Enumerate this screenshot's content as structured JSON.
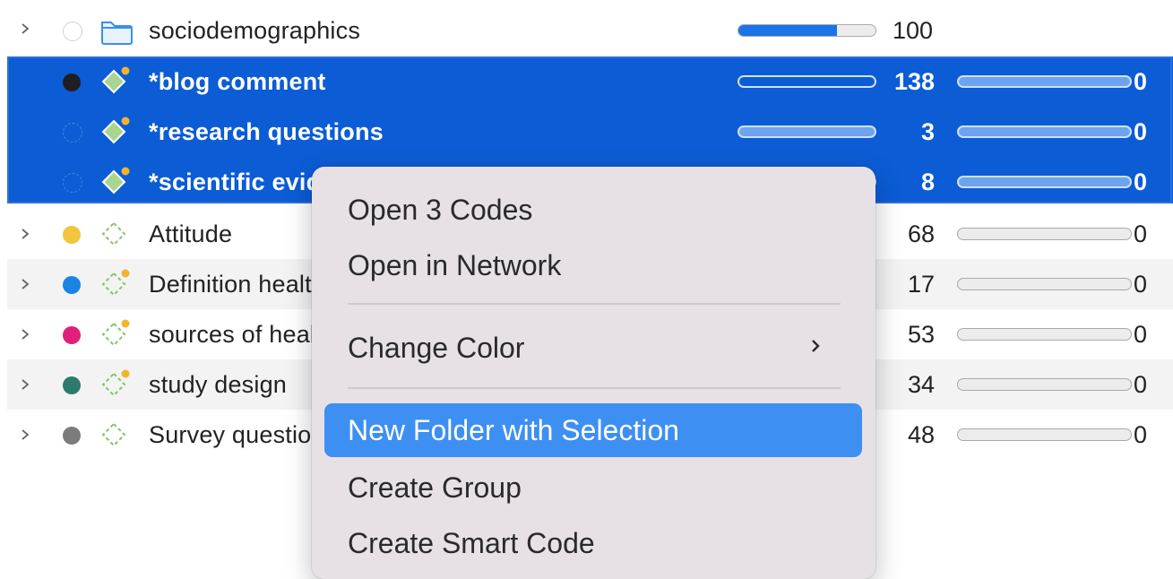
{
  "rows": [
    {
      "name": "sociodemographics",
      "type": "folder",
      "count": "100",
      "fill": 0.72,
      "second": ""
    },
    {
      "name": "*blog comment",
      "type": "code-selected",
      "count": "138",
      "second": "0",
      "color": "#1f1f1f"
    },
    {
      "name": "*research questions",
      "type": "code-selected",
      "count": "3",
      "second": "0"
    },
    {
      "name": "*scientific evidence",
      "type": "code-selected",
      "count": "8",
      "second": "0"
    },
    {
      "name": "Attitude",
      "type": "code",
      "count": "68",
      "second": "0",
      "color": "#f2c53d"
    },
    {
      "name": "Definition health literacy",
      "type": "code",
      "count": "17",
      "second": "0",
      "color": "#1a84e6"
    },
    {
      "name": "sources of health information",
      "type": "code",
      "count": "53",
      "second": "0",
      "color": "#e0207a"
    },
    {
      "name": "study design",
      "type": "code",
      "count": "34",
      "second": "0",
      "color": "#2e7a6d"
    },
    {
      "name": "Survey questions",
      "type": "code",
      "count": "48",
      "second": "0",
      "color": "#7c7c7c"
    }
  ],
  "menu": {
    "open_codes": "Open 3 Codes",
    "open_network": "Open in Network",
    "change_color": "Change Color",
    "new_folder": "New Folder with Selection",
    "create_group": "Create Group",
    "create_smart": "Create Smart Code"
  },
  "icons": {
    "chevron": "chevron-right-icon",
    "folder": "folder-icon",
    "code": "code-diamond-icon",
    "submenu": "chevron-right-icon"
  },
  "colors": {
    "selection": "#0b5cd5",
    "highlight": "#3d8ff2",
    "accent": "#1a73e8"
  }
}
